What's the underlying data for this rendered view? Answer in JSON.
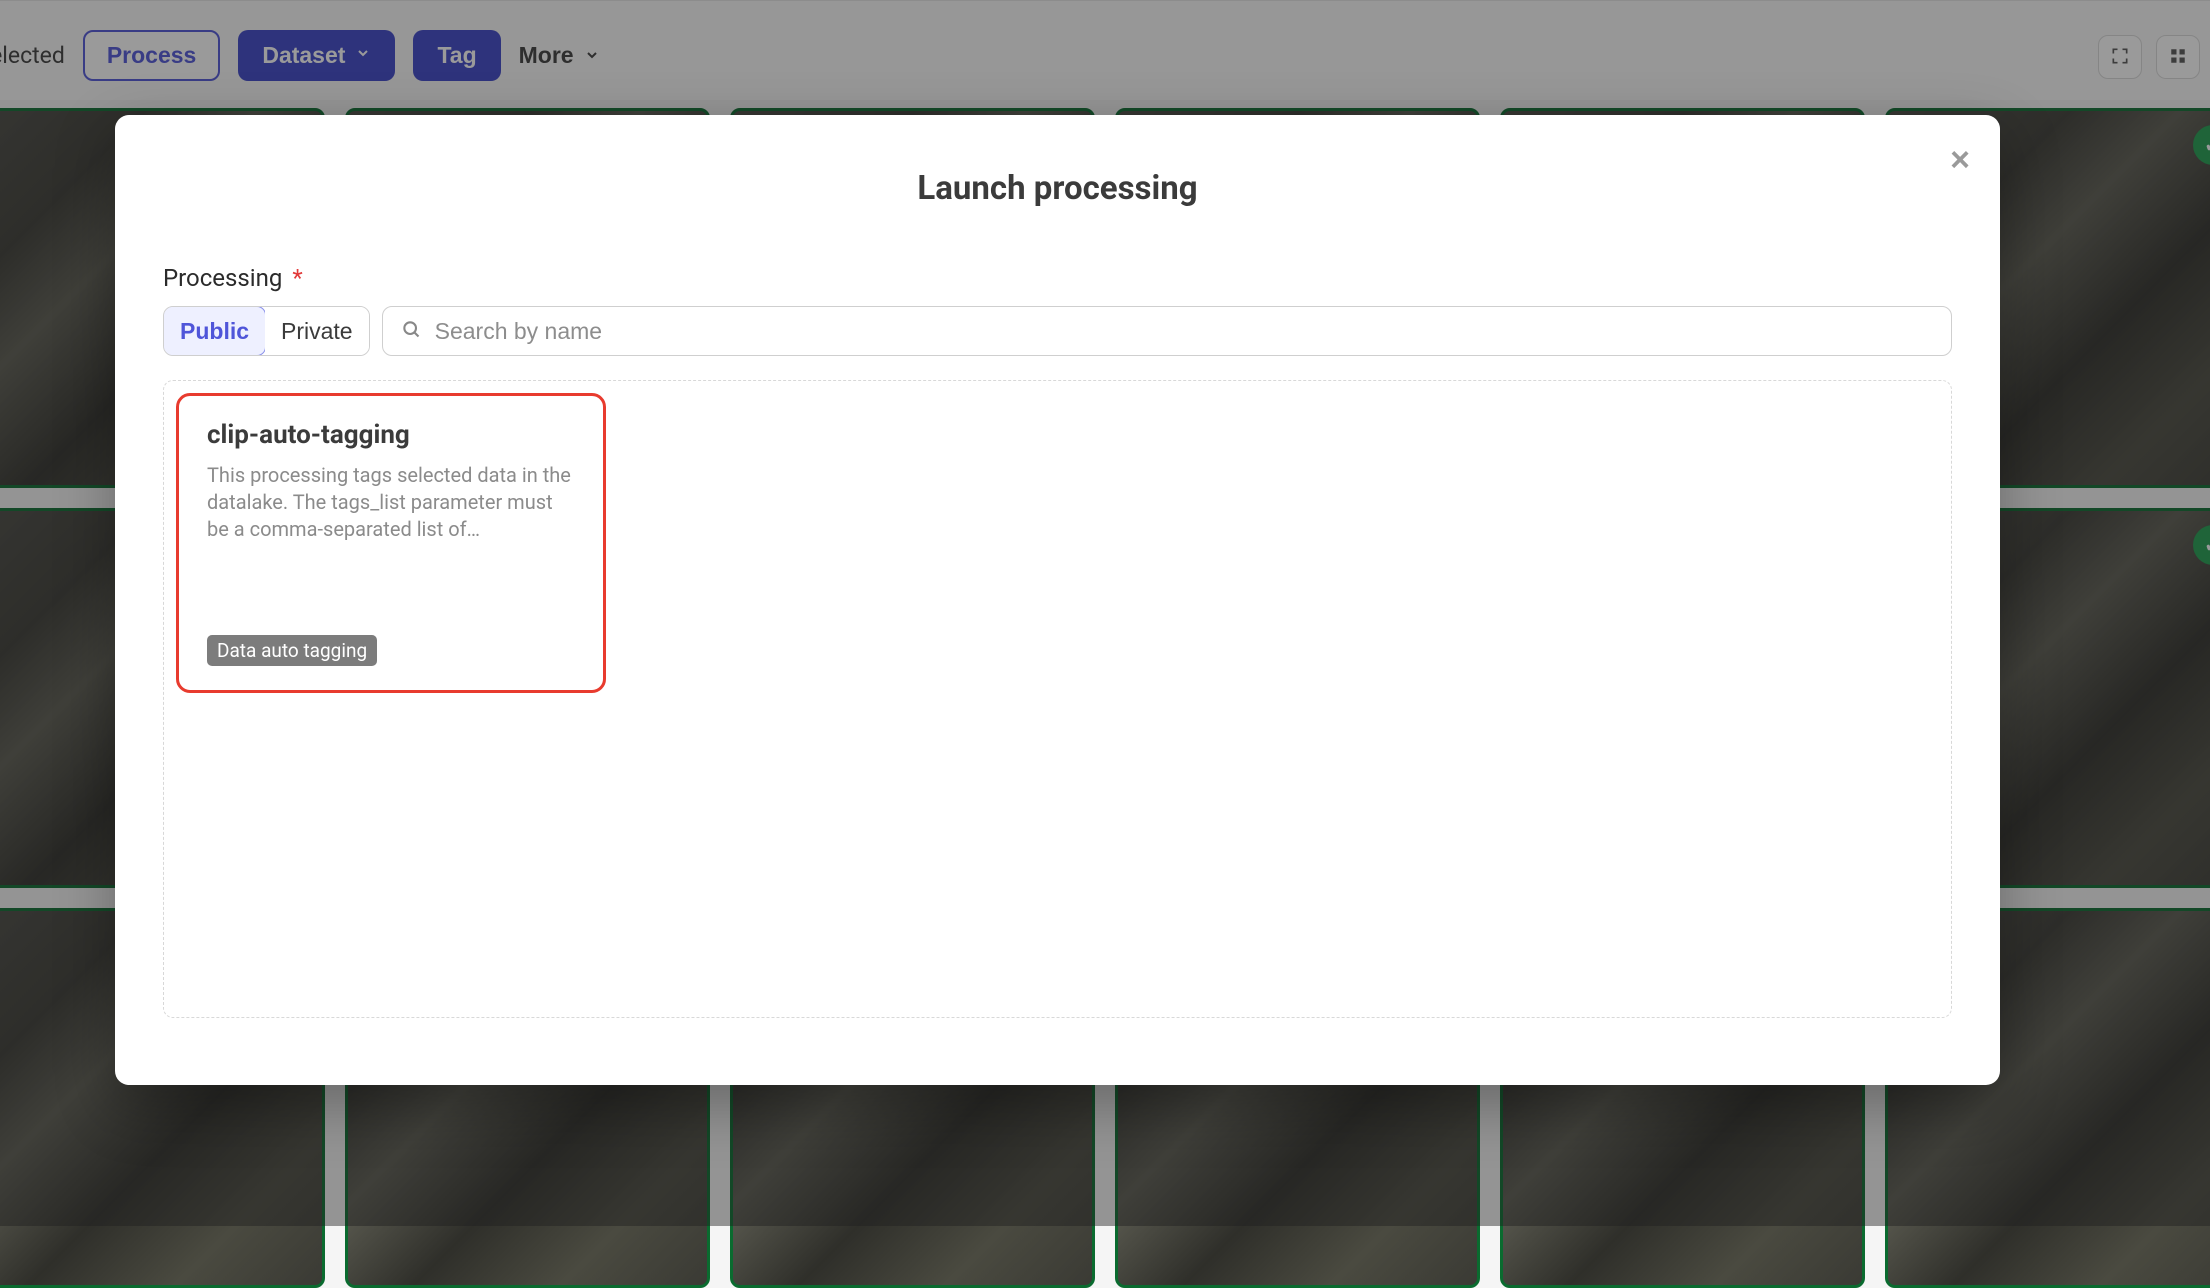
{
  "toolbar": {
    "selected_text": "a selected",
    "process_label": "Process",
    "dataset_label": "Dataset",
    "tag_label": "Tag",
    "more_label": "More"
  },
  "modal": {
    "title": "Launch processing",
    "field_label": "Processing",
    "required_mark": "*",
    "toggle_public": "Public",
    "toggle_private": "Private",
    "search_placeholder": "Search by name",
    "card": {
      "title": "clip-auto-tagging",
      "description": "This processing tags selected data in the datalake. The tags_list parameter must be a comma-separated list of…",
      "tag": "Data auto tagging"
    }
  }
}
